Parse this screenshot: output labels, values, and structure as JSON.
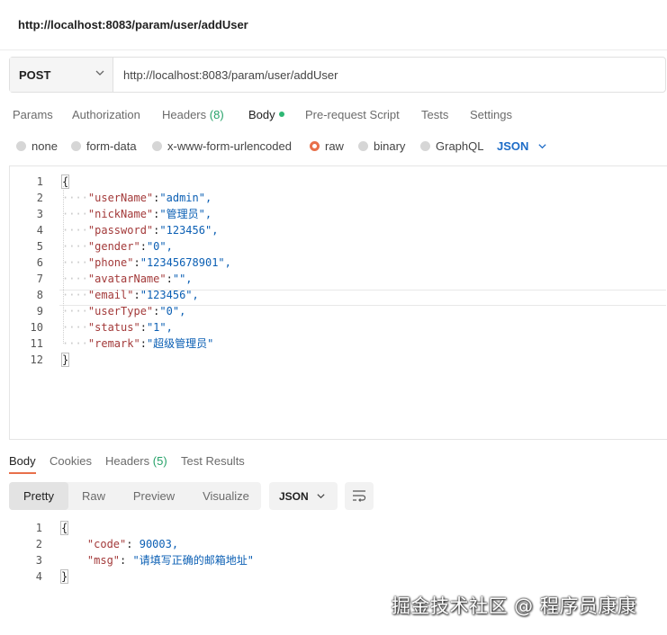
{
  "window": {
    "title": "http://localhost:8083/param/user/addUser"
  },
  "request": {
    "method": "POST",
    "url": "http://localhost:8083/param/user/addUser"
  },
  "request_tabs": [
    {
      "label": "Params"
    },
    {
      "label": "Authorization"
    },
    {
      "label": "Headers",
      "count": "(8)"
    },
    {
      "label": "Body"
    },
    {
      "label": "Pre-request Script"
    },
    {
      "label": "Tests"
    },
    {
      "label": "Settings"
    }
  ],
  "body_types": [
    {
      "label": "none"
    },
    {
      "label": "form-data"
    },
    {
      "label": "x-www-form-urlencoded"
    },
    {
      "label": "raw",
      "selected": true
    },
    {
      "label": "binary"
    },
    {
      "label": "GraphQL"
    }
  ],
  "raw_format": "JSON",
  "request_body": [
    {
      "n": "1",
      "text": "{"
    },
    {
      "n": "2",
      "key": "\"userName\"",
      "val": "\"admin\","
    },
    {
      "n": "3",
      "key": "\"nickName\"",
      "val": "\"管理员\","
    },
    {
      "n": "4",
      "key": "\"password\"",
      "val": "\"123456\","
    },
    {
      "n": "5",
      "key": "\"gender\"",
      "val": "\"0\","
    },
    {
      "n": "6",
      "key": "\"phone\"",
      "val": "\"12345678901\","
    },
    {
      "n": "7",
      "key": "\"avatarName\"",
      "val": "\"\","
    },
    {
      "n": "8",
      "key": "\"email\"",
      "val": "\"123456\","
    },
    {
      "n": "9",
      "key": "\"userType\"",
      "val": "\"0\","
    },
    {
      "n": "10",
      "key": "\"status\"",
      "val": "\"1\","
    },
    {
      "n": "11",
      "key": "\"remark\"",
      "val": "\"超级管理员\""
    },
    {
      "n": "12",
      "text": "}"
    }
  ],
  "response_tabs": [
    {
      "label": "Body"
    },
    {
      "label": "Cookies"
    },
    {
      "label": "Headers",
      "count": "(5)"
    },
    {
      "label": "Test Results"
    }
  ],
  "view_modes": [
    "Pretty",
    "Raw",
    "Preview",
    "Visualize"
  ],
  "response_format": "JSON",
  "response_body": [
    {
      "n": "1",
      "text": "{"
    },
    {
      "n": "2",
      "key": "\"code\"",
      "val": " 90003,"
    },
    {
      "n": "3",
      "key": "\"msg\"",
      "val": " \"请填写正确的邮箱地址\""
    },
    {
      "n": "4",
      "text": "}"
    }
  ],
  "watermark": "掘金技术社区 @ 程序员康康",
  "colors": {
    "accent_orange": "#e8704a",
    "status_green": "#26a269",
    "link_blue": "#1d6cc7"
  }
}
